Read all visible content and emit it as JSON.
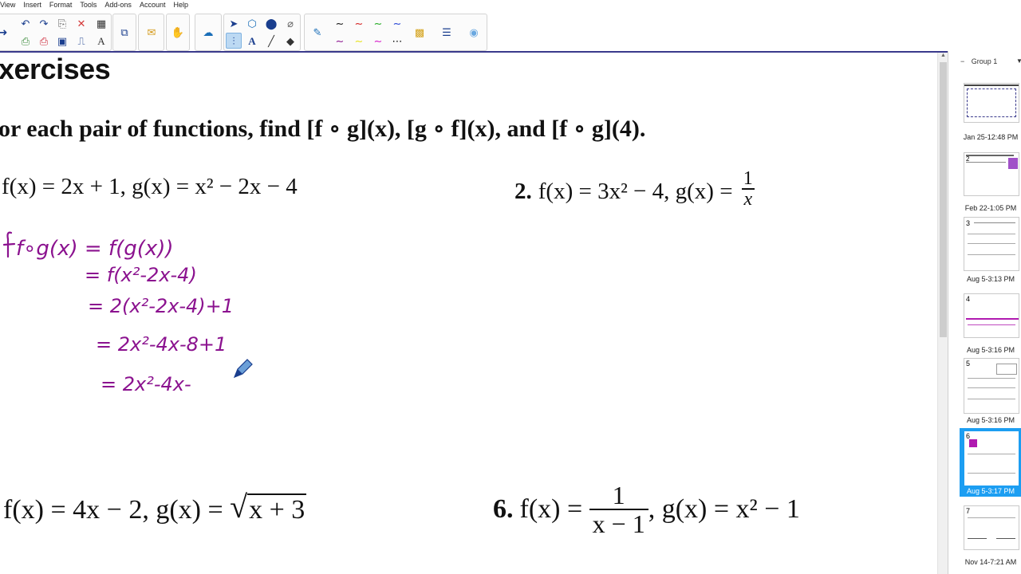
{
  "menu": [
    "View",
    "Insert",
    "Format",
    "Tools",
    "Add-ons",
    "Account",
    "Help"
  ],
  "toolbar": {
    "icons": [
      "arrow-right-icon",
      "undo-icon",
      "redo-icon",
      "paste-icon",
      "delete-icon",
      "table-icon",
      "new-page-icon",
      "delete-page-icon",
      "save-icon",
      "text-tool-icon",
      "screen-capture-icon",
      "gallery-icon",
      "hand-icon",
      "shapes-icon",
      "select-arrow-icon",
      "zoom-icon",
      "fill-icon",
      "eraser-shape-icon",
      "text-icon",
      "line-icon",
      "eraser-icon",
      "pen-icon",
      "pen-black-icon",
      "pen-red-icon",
      "pen-green-icon",
      "pen-blue-icon",
      "pen-purple-icon",
      "highlighter-yellow-icon",
      "pen-magenta-icon",
      "pen-dashed-icon",
      "color-grid-icon",
      "properties-icon",
      "doc-camera-icon"
    ]
  },
  "document": {
    "heading": "xercises",
    "instruction": "or each pair of functions, find [f ∘ g](x), [g ∘ f](x), and [f ∘ g](4).",
    "problem1": "f(x) = 2x + 1, g(x) = x² − 2x − 4",
    "problem2_num": "2.",
    "problem2_a": "f(x) = 3x² − 4, g(x) = ",
    "problem2_frac_num": "1",
    "problem2_frac_den": "x",
    "problem5_a": "f(x) = 4x − 2, g(x) = ",
    "problem5_root": "x + 3",
    "problem6_num": "6.",
    "problem6_a": "f(x) = ",
    "problem6_frac_num": "1",
    "problem6_frac_den": "x − 1",
    "problem6_b": ", g(x) = x² − 1"
  },
  "handwriting": {
    "color": "#8b128f",
    "line1": "f∘g(x) = f(g(x))",
    "line2": "= f(x²-2x-4)",
    "line3": "= 2(x²-2x-4)+1",
    "line4": "= 2x²-4x-8+1",
    "line5": "= 2x²-4x-"
  },
  "sidebar": {
    "group": "Group 1",
    "pages": [
      {
        "caption": "Jan 25-12:48 PM",
        "num": ""
      },
      {
        "caption": "Feb 22-1:05 PM",
        "num": "2"
      },
      {
        "caption": "Aug 5-3:13 PM",
        "num": "3"
      },
      {
        "caption": "Aug 5-3:16 PM",
        "num": "4"
      },
      {
        "caption": "Aug 5-3:16 PM",
        "num": "5"
      },
      {
        "caption": "Aug 5-3:17 PM",
        "num": "6",
        "active": true
      },
      {
        "caption": "Nov 14-7:21 AM",
        "num": "7"
      }
    ]
  },
  "colors": {
    "accent": "#1c9ef2",
    "ink": "#8b128f",
    "frame": "#3a3a8c"
  }
}
